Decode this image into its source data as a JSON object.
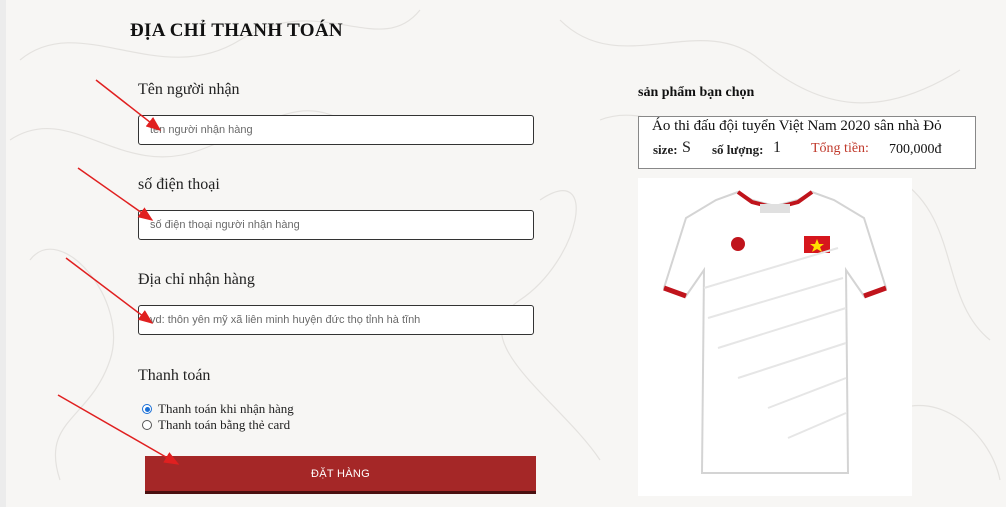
{
  "page": {
    "title": "ĐỊA CHỈ THANH TOÁN"
  },
  "form": {
    "name_label": "Tên người nhận",
    "name_placeholder": "tên người nhận hàng",
    "phone_label": "số điện thoại",
    "phone_placeholder": "số điện thoại người nhận hàng",
    "address_label": "Địa chỉ nhận hàng",
    "address_placeholder": "vd: thôn yên mỹ xã liên minh huyện đức thọ tỉnh hà tĩnh",
    "payment_label": "Thanh toán",
    "payment_options": [
      {
        "label": "Thanh toán khi nhận hàng",
        "selected": true
      },
      {
        "label": "Thanh toán bằng thẻ card",
        "selected": false
      }
    ],
    "submit_label": "ĐẶT HÀNG"
  },
  "summary": {
    "title": "sản phẩm bạn chọn",
    "product_name": "Áo thi đấu đội tuyển Việt Nam 2020 sân nhà Đỏ",
    "size_label": "size:",
    "size_value": "S",
    "qty_label": "số lượng:",
    "qty_value": "1",
    "total_label": "Tổng tiền:",
    "total_value": "700,000đ",
    "image_icon": "white-football-jersey-image"
  },
  "colors": {
    "accent": "#a52727",
    "total_label": "#c0392b",
    "annotation_arrow": "#e02020",
    "radio_selected": "#1a6fd6"
  },
  "annotations": {
    "arrow_icon": "red-pointer-arrow",
    "count": 4
  }
}
